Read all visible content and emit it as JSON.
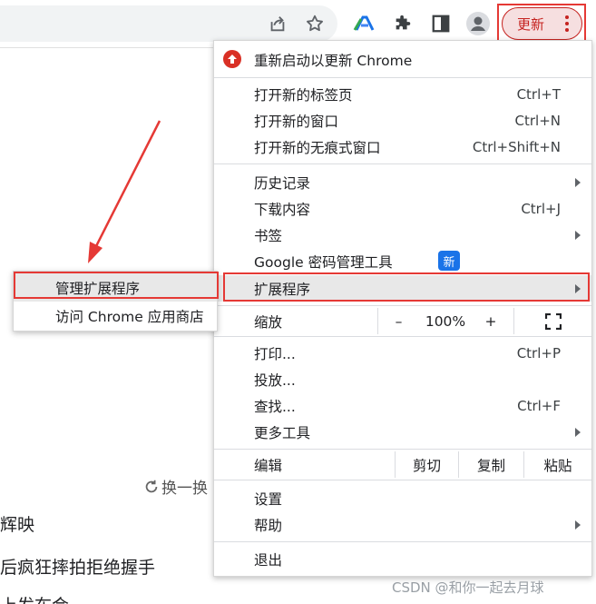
{
  "toolbar": {
    "update_label": "更新",
    "icons": [
      "share-icon",
      "bookmark-star-icon",
      "extension-a-icon",
      "puzzle-extensions-icon",
      "side-panel-icon",
      "profile-avatar-icon",
      "kebab-menu-icon"
    ]
  },
  "background": {
    "refresh_label": "换一换",
    "news_lines": [
      "辉映",
      "后疯狂摔拍拒绝握手",
      "上发布会"
    ],
    "watermark": "CSDN @和你一起去月球"
  },
  "menu": {
    "restart": "重新启动以更新 Chrome",
    "new_tab": {
      "label": "打开新的标签页",
      "shortcut": "Ctrl+T"
    },
    "new_window": {
      "label": "打开新的窗口",
      "shortcut": "Ctrl+N"
    },
    "incognito": {
      "label": "打开新的无痕式窗口",
      "shortcut": "Ctrl+Shift+N"
    },
    "history": {
      "label": "历史记录"
    },
    "downloads": {
      "label": "下载内容",
      "shortcut": "Ctrl+J"
    },
    "bookmarks": {
      "label": "书签"
    },
    "password_manager": {
      "label": "Google 密码管理工具",
      "badge": "新"
    },
    "extensions": {
      "label": "扩展程序"
    },
    "zoom": {
      "label": "缩放",
      "minus": "–",
      "value": "100%",
      "plus": "+"
    },
    "print": {
      "label": "打印...",
      "shortcut": "Ctrl+P"
    },
    "cast": {
      "label": "投放..."
    },
    "find": {
      "label": "查找...",
      "shortcut": "Ctrl+F"
    },
    "more_tools": {
      "label": "更多工具"
    },
    "edit": {
      "label": "编辑",
      "cut": "剪切",
      "copy": "复制",
      "paste": "粘贴"
    },
    "settings": {
      "label": "设置"
    },
    "help": {
      "label": "帮助"
    },
    "exit": {
      "label": "退出"
    }
  },
  "submenu": {
    "manage": "管理扩展程序",
    "store": "访问 Chrome 应用商店"
  },
  "colors": {
    "accent_red": "#e53935",
    "update_red": "#c5221f",
    "badge_blue": "#1a73e8"
  }
}
